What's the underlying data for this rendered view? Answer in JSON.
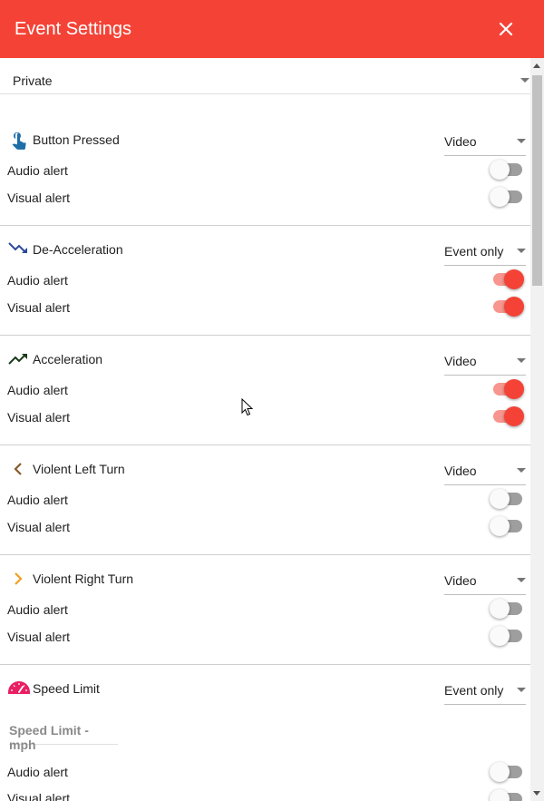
{
  "header": {
    "title": "Event Settings",
    "close_icon": "close-icon"
  },
  "privacy": {
    "value": "Private"
  },
  "alerts": {
    "audio_label": "Audio alert",
    "visual_label": "Visual alert"
  },
  "events": [
    {
      "name": "Button Pressed",
      "icon": "touch-hand-icon",
      "mode": "Video",
      "audio": false,
      "visual": false
    },
    {
      "name": "De-Acceleration",
      "icon": "trending-down-icon",
      "mode": "Event only",
      "audio": true,
      "visual": true
    },
    {
      "name": "Acceleration",
      "icon": "trending-up-icon",
      "mode": "Video",
      "audio": true,
      "visual": true
    },
    {
      "name": "Violent Left Turn",
      "icon": "chevron-left-icon",
      "mode": "Video",
      "audio": false,
      "visual": false
    },
    {
      "name": "Violent Right Turn",
      "icon": "chevron-right-icon",
      "mode": "Video",
      "audio": false,
      "visual": false
    },
    {
      "name": "Speed Limit",
      "icon": "speedometer-icon",
      "mode": "Event only",
      "audio": false,
      "visual": false
    }
  ],
  "speed_limit": {
    "field_label": "Speed Limit - mph"
  },
  "colors": {
    "accent": "#f44336",
    "toggle_on_track": "#f7958e",
    "toggle_off_track": "#9e9e9e"
  }
}
